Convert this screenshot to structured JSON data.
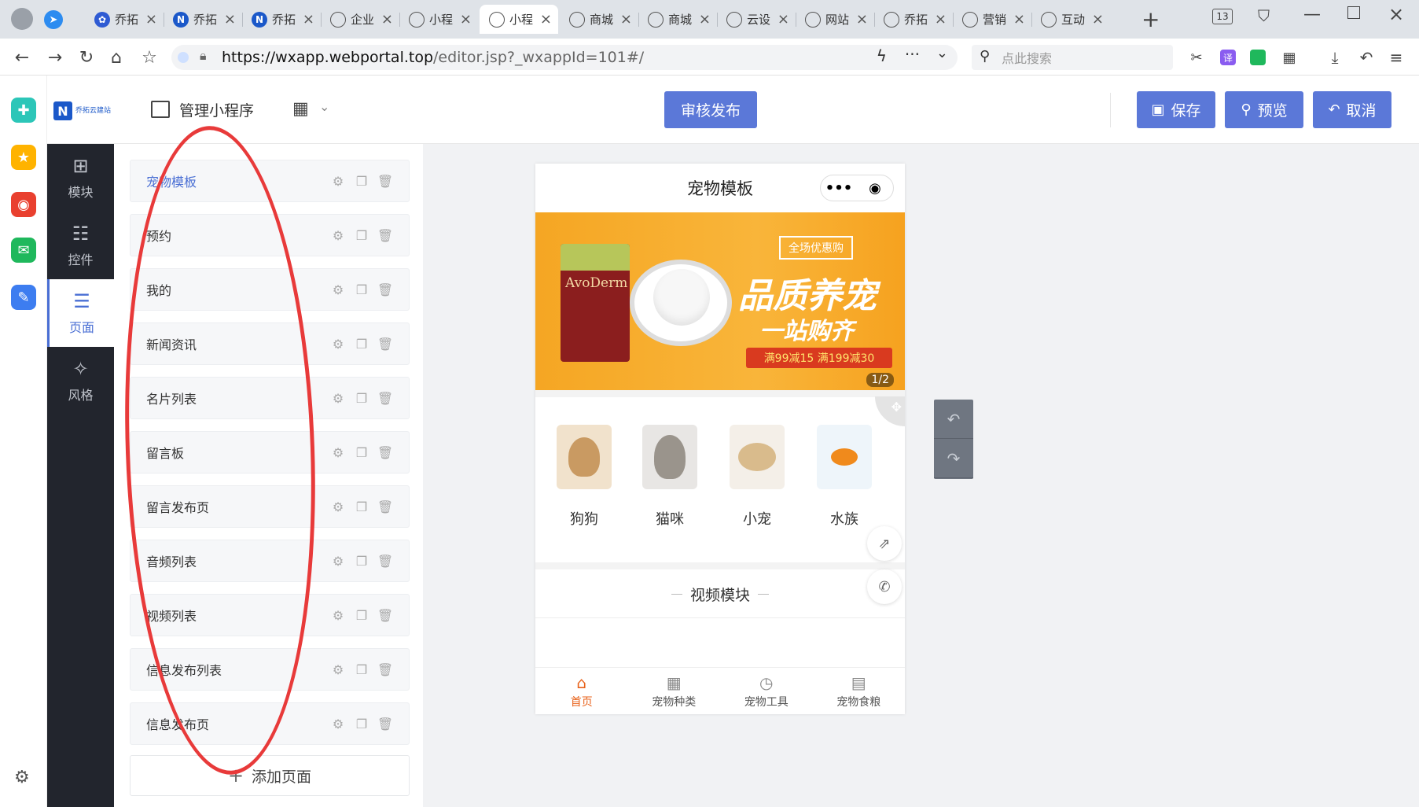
{
  "browser": {
    "tabs": [
      {
        "label": "乔拓",
        "icon": "paw-icon",
        "color": "#2f5bd3"
      },
      {
        "label": "乔拓",
        "icon": "n-logo-icon",
        "color": "#1b58c9"
      },
      {
        "label": "乔拓",
        "icon": "n-logo-icon",
        "color": "#1b58c9"
      },
      {
        "label": "企业",
        "icon": "globe-icon",
        "color": "#666"
      },
      {
        "label": "小程",
        "icon": "globe-icon",
        "color": "#666"
      },
      {
        "label": "小程",
        "icon": "globe-icon",
        "color": "#666"
      },
      {
        "label": "商城",
        "icon": "globe-icon",
        "color": "#666"
      },
      {
        "label": "商城",
        "icon": "globe-icon",
        "color": "#666"
      },
      {
        "label": "云设",
        "icon": "globe-icon",
        "color": "#666"
      },
      {
        "label": "网站",
        "icon": "globe-icon",
        "color": "#666"
      },
      {
        "label": "乔拓",
        "icon": "globe-icon",
        "color": "#666"
      },
      {
        "label": "营销",
        "icon": "globe-icon",
        "color": "#666"
      },
      {
        "label": "互动",
        "icon": "globe-icon",
        "color": "#666"
      }
    ],
    "tab_count": "13",
    "url_host": "https://wxapp.webportal.top",
    "url_rest": "/editor.jsp?_wxappId=101#/",
    "search_placeholder": "点此搜索"
  },
  "header": {
    "manage_label": "管理小程序",
    "publish_label": "审核发布",
    "save_label": "保存",
    "preview_label": "预览",
    "cancel_label": "取消",
    "logo_text": "乔拓云建站"
  },
  "rail": {
    "items": [
      {
        "label": "模块",
        "icon": "plus-square-icon"
      },
      {
        "label": "控件",
        "icon": "sliders-icon"
      },
      {
        "label": "页面",
        "icon": "pages-icon"
      },
      {
        "label": "风格",
        "icon": "magic-wand-icon"
      }
    ]
  },
  "pages": {
    "items": [
      "宠物模板",
      "预约",
      "我的",
      "新闻资讯",
      "名片列表",
      "留言板",
      "留言发布页",
      "音频列表",
      "视频列表",
      "信息发布列表",
      "信息发布页"
    ],
    "add_label": "添加页面"
  },
  "preview": {
    "title": "宠物模板",
    "banner": {
      "tagline": "全场优惠购",
      "headline": "品质养宠",
      "subline": "一站购齐",
      "promo": "满99减15  满199减30",
      "pager": "1/2",
      "brand": "AvoDerm"
    },
    "categories": [
      "狗狗",
      "猫咪",
      "小宠",
      "水族"
    ],
    "video_title": "视频模块",
    "tabbar": [
      {
        "label": "首页",
        "icon": "home-icon"
      },
      {
        "label": "宠物种类",
        "icon": "grid-icon"
      },
      {
        "label": "宠物工具",
        "icon": "clock-icon"
      },
      {
        "label": "宠物食粮",
        "icon": "document-icon"
      }
    ]
  },
  "colors": {
    "accent": "#5b78d8",
    "rail_bg": "#22252d",
    "active_tab": "#e8621a",
    "annotation": "#e83a3a"
  }
}
